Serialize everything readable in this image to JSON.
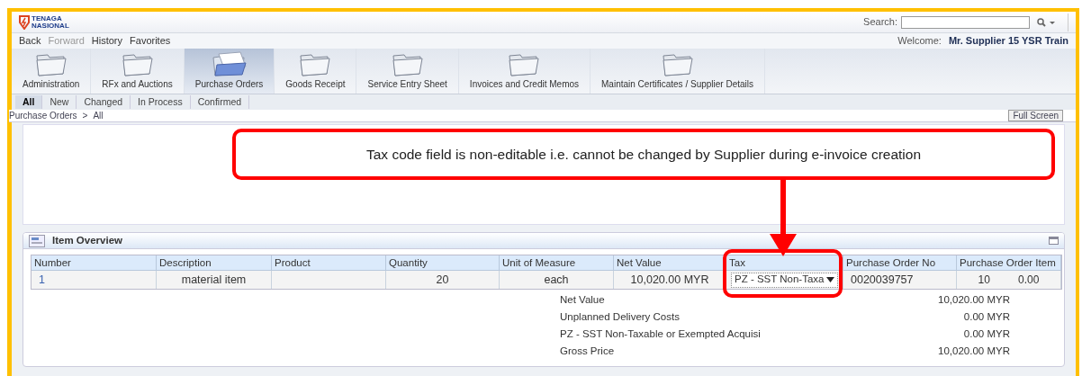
{
  "header": {
    "logo_text": "TENAGA NASIONAL",
    "search_label": "Search:"
  },
  "nav": {
    "links": [
      {
        "label": "Back",
        "disabled": false
      },
      {
        "label": "Forward",
        "disabled": true
      },
      {
        "label": "History",
        "disabled": false
      },
      {
        "label": "Favorites",
        "disabled": false
      }
    ],
    "welcome": "Welcome:",
    "user": "Mr. Supplier 15 YSR Train"
  },
  "tabs": [
    {
      "label": "Administration",
      "selected": false
    },
    {
      "label": "RFx and Auctions",
      "selected": false
    },
    {
      "label": "Purchase Orders",
      "selected": true
    },
    {
      "label": "Goods Receipt",
      "selected": false
    },
    {
      "label": "Service Entry Sheet",
      "selected": false
    },
    {
      "label": "Invoices and Credit Memos",
      "selected": false
    },
    {
      "label": "Maintain Certificates / Supplier Details",
      "selected": false
    }
  ],
  "subtabs": [
    {
      "label": "All",
      "selected": true
    },
    {
      "label": "New",
      "selected": false
    },
    {
      "label": "Changed",
      "selected": false
    },
    {
      "label": "In Process",
      "selected": false
    },
    {
      "label": "Confirmed",
      "selected": false
    }
  ],
  "breadcrumb": [
    "Purchase Orders",
    ">",
    "All"
  ],
  "full_screen_button": "Full Screen",
  "callout": {
    "text": "Tax code field is non-editable i.e. cannot be changed by Supplier during e-invoice creation"
  },
  "item_overview": {
    "title": "Item Overview",
    "columns": [
      "Number",
      "Description",
      "Product",
      "Quantity",
      "Unit of Measure",
      "Net Value",
      "Tax",
      "Purchase Order No",
      "Purchase Order Item"
    ],
    "rows": [
      {
        "cells": [
          {
            "kind": "link",
            "text": "1"
          },
          {
            "kind": "center",
            "text": "material item"
          },
          {
            "kind": "empty"
          },
          {
            "kind": "center",
            "text": "20"
          },
          {
            "kind": "center",
            "text": "each"
          },
          {
            "kind": "center",
            "text": "10,020.00 MYR"
          },
          {
            "kind": "dropdown",
            "text": "PZ - SST Non-Taxa",
            "highlighted": true
          },
          {
            "kind": "left",
            "text": "0020039757"
          },
          {
            "kind": "pair",
            "text": "10",
            "extra": "0.00"
          }
        ]
      }
    ],
    "summary": [
      {
        "label": "Net Value",
        "value": "10,020.00 MYR"
      },
      {
        "label": "Unplanned Delivery Costs",
        "value": "0.00 MYR"
      },
      {
        "label": "PZ - SST Non-Taxable or Exempted Acquisi",
        "value": "0.00 MYR"
      },
      {
        "label": "Gross Price",
        "value": "10,020.00 MYR"
      }
    ]
  }
}
